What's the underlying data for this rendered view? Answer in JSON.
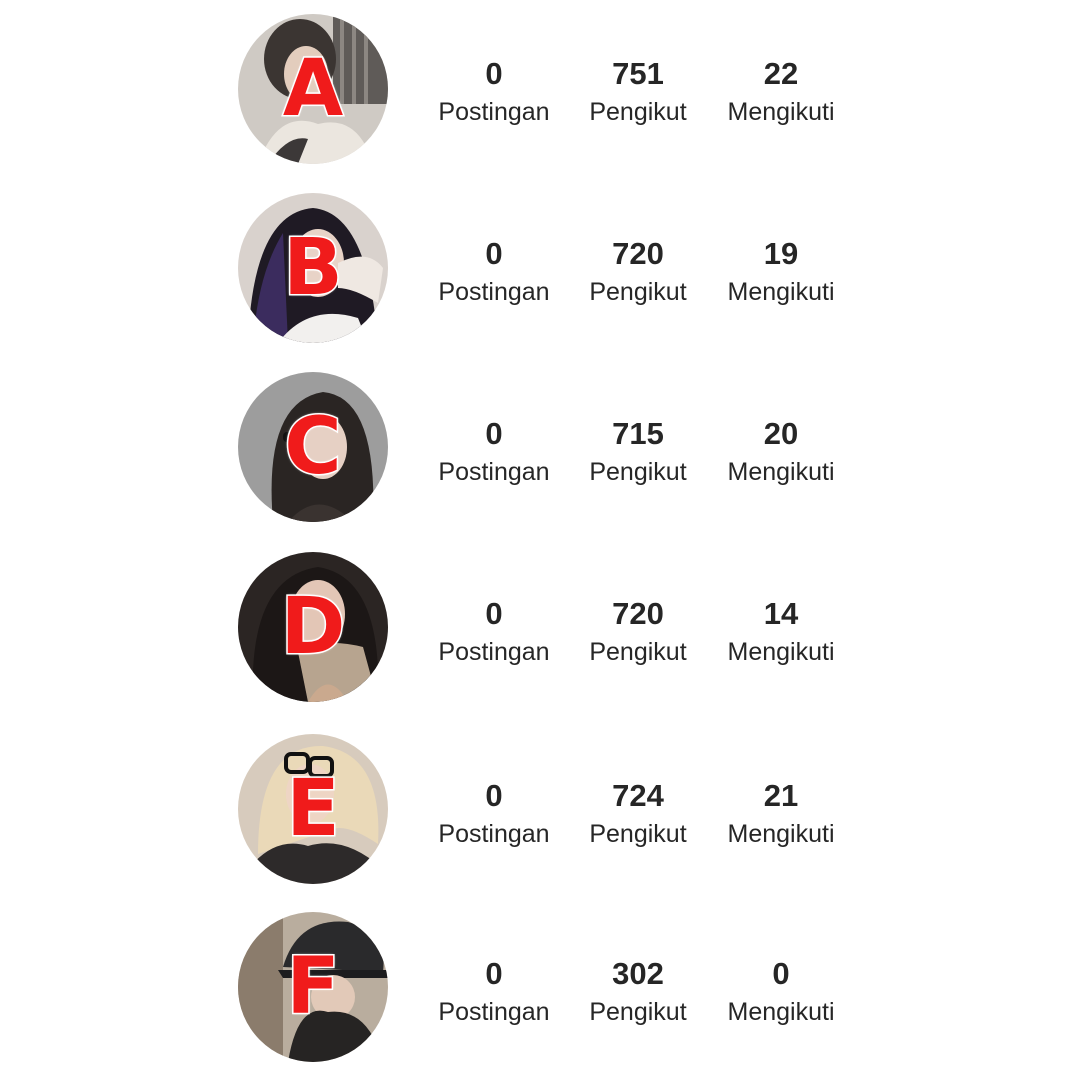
{
  "profiles": [
    {
      "letter": "A",
      "posts": {
        "value": "0",
        "label": "Postingan"
      },
      "followers": {
        "value": "751",
        "label": "Pengikut"
      },
      "following": {
        "value": "22",
        "label": "Mengikuti"
      }
    },
    {
      "letter": "B",
      "posts": {
        "value": "0",
        "label": "Postingan"
      },
      "followers": {
        "value": "720",
        "label": "Pengikut"
      },
      "following": {
        "value": "19",
        "label": "Mengikuti"
      }
    },
    {
      "letter": "C",
      "posts": {
        "value": "0",
        "label": "Postingan"
      },
      "followers": {
        "value": "715",
        "label": "Pengikut"
      },
      "following": {
        "value": "20",
        "label": "Mengikuti"
      }
    },
    {
      "letter": "D",
      "posts": {
        "value": "0",
        "label": "Postingan"
      },
      "followers": {
        "value": "720",
        "label": "Pengikut"
      },
      "following": {
        "value": "14",
        "label": "Mengikuti"
      }
    },
    {
      "letter": "E",
      "posts": {
        "value": "0",
        "label": "Postingan"
      },
      "followers": {
        "value": "724",
        "label": "Pengikut"
      },
      "following": {
        "value": "21",
        "label": "Mengikuti"
      }
    },
    {
      "letter": "F",
      "posts": {
        "value": "0",
        "label": "Postingan"
      },
      "followers": {
        "value": "302",
        "label": "Pengikut"
      },
      "following": {
        "value": "0",
        "label": "Mengikuti"
      }
    }
  ],
  "colors": {
    "letter_fill": "#f01b1b",
    "letter_outline": "#ffffff",
    "text": "#262626"
  }
}
